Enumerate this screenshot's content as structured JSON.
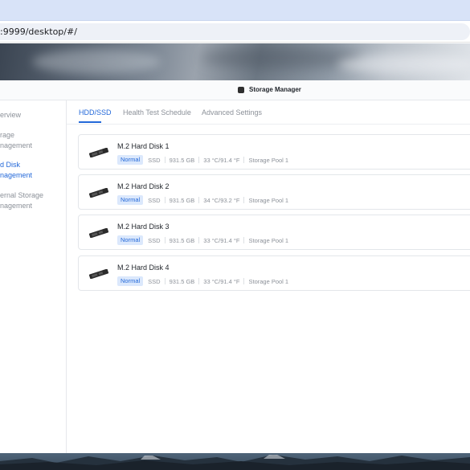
{
  "browser": {
    "url": ":9999/desktop/#/"
  },
  "window": {
    "title": "Storage Manager",
    "icon": "storage-manager-icon"
  },
  "sidebar": {
    "items": [
      {
        "label": "erview",
        "active": false
      },
      {
        "label": "rage\nnagement",
        "active": false
      },
      {
        "label": "d Disk\nnagement",
        "active": true
      },
      {
        "label": "ernal Storage\nnagement",
        "active": false
      }
    ]
  },
  "tabs": [
    {
      "label": "HDD/SSD",
      "active": true
    },
    {
      "label": "Health Test Schedule",
      "active": false
    },
    {
      "label": "Advanced Settings",
      "active": false
    }
  ],
  "disks": [
    {
      "name": "M.2 Hard Disk 1",
      "status": "Normal",
      "type": "SSD",
      "size": "931.5 GB",
      "temp": "33 °C/91.4 °F",
      "pool": "Storage Pool 1"
    },
    {
      "name": "M.2 Hard Disk 2",
      "status": "Normal",
      "type": "SSD",
      "size": "931.5 GB",
      "temp": "34 °C/93.2 °F",
      "pool": "Storage Pool 1"
    },
    {
      "name": "M.2 Hard Disk 3",
      "status": "Normal",
      "type": "SSD",
      "size": "931.5 GB",
      "temp": "33 °C/91.4 °F",
      "pool": "Storage Pool 1"
    },
    {
      "name": "M.2 Hard Disk 4",
      "status": "Normal",
      "type": "SSD",
      "size": "931.5 GB",
      "temp": "33 °C/91.4 °F",
      "pool": "Storage Pool 1"
    }
  ],
  "colors": {
    "accent": "#2469d9",
    "badge_bg": "#dbe8fc",
    "muted_text": "#8c9199"
  }
}
